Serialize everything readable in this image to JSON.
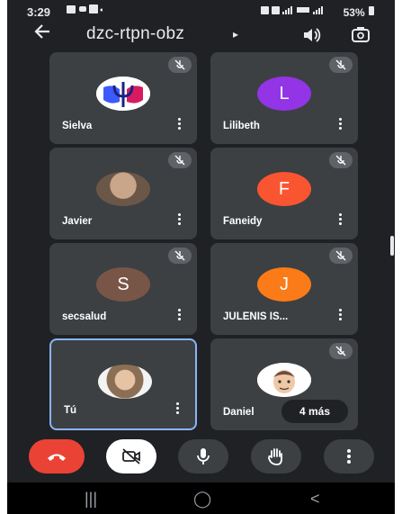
{
  "status_bar": {
    "time": "3:29",
    "battery": "53%"
  },
  "header": {
    "meeting_code": "dzc-rtpn-obz"
  },
  "tiles": [
    {
      "name": "Sielva",
      "avatar": "psi-logo",
      "avatar_color": "#3d5afe",
      "muted": true
    },
    {
      "name": "Lilibeth",
      "avatar": "L",
      "avatar_color": "#9334e6",
      "muted": true
    },
    {
      "name": "Javier",
      "avatar": "photo",
      "muted": true
    },
    {
      "name": "Faneidy",
      "avatar": "F",
      "avatar_color": "#f95530",
      "muted": true
    },
    {
      "name": "secsalud",
      "avatar": "S",
      "avatar_color": "#795548",
      "muted": true
    },
    {
      "name": "JULENIS IS...",
      "avatar": "J",
      "avatar_color": "#fa7b17",
      "muted": true
    },
    {
      "name": "Tú",
      "avatar": "photo",
      "muted": false,
      "self": true
    },
    {
      "name": "Daniel",
      "avatar": "memoji",
      "muted": true,
      "more_label": "4 más"
    }
  ],
  "controls": {
    "end_call_color": "#ea4335",
    "icons": [
      "phone-hangup-icon",
      "camera-off-icon",
      "microphone-icon",
      "raise-hand-icon",
      "more-options-icon"
    ]
  },
  "nav_bar": {
    "recents": "|||",
    "home": "◯",
    "back": "<"
  }
}
